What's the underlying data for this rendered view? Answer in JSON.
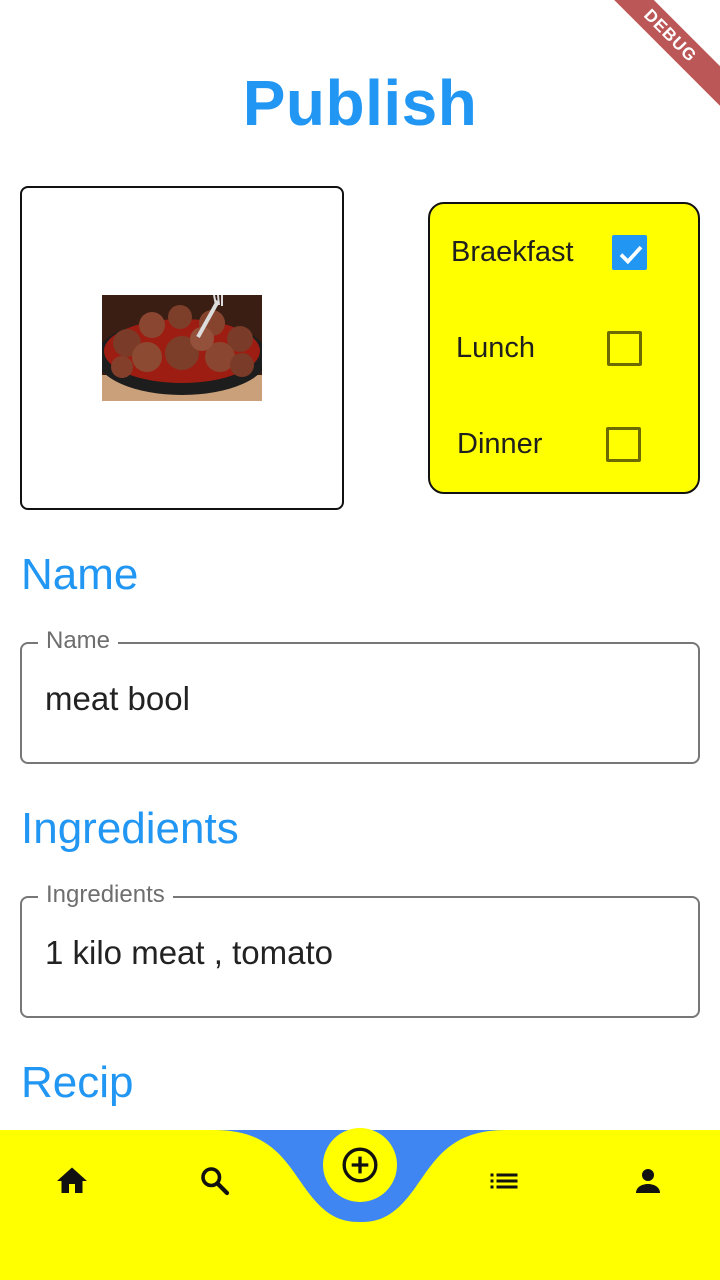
{
  "page": {
    "title": "Publish",
    "debug_banner": "DEBUG"
  },
  "image": {
    "alt": "meatballs in tomato sauce"
  },
  "meal_options": [
    {
      "label": "Braekfast",
      "checked": true
    },
    {
      "label": "Lunch",
      "checked": false
    },
    {
      "label": "Dinner",
      "checked": false
    }
  ],
  "sections": {
    "name": {
      "heading": "Name",
      "field_label": "Name",
      "value": "meat bool"
    },
    "ingredients": {
      "heading": "Ingredients",
      "field_label": "Ingredients",
      "value": "1 kilo meat , tomato"
    },
    "recipe": {
      "heading": "Recip"
    }
  },
  "bottom_nav": {
    "items": [
      "home-icon",
      "search-icon",
      "add-circle-icon",
      "list-icon",
      "person-icon"
    ],
    "active": "add-circle-icon"
  },
  "colors": {
    "accent": "#2196f3",
    "yellow": "#ffff00",
    "notch": "#3f86f2"
  }
}
